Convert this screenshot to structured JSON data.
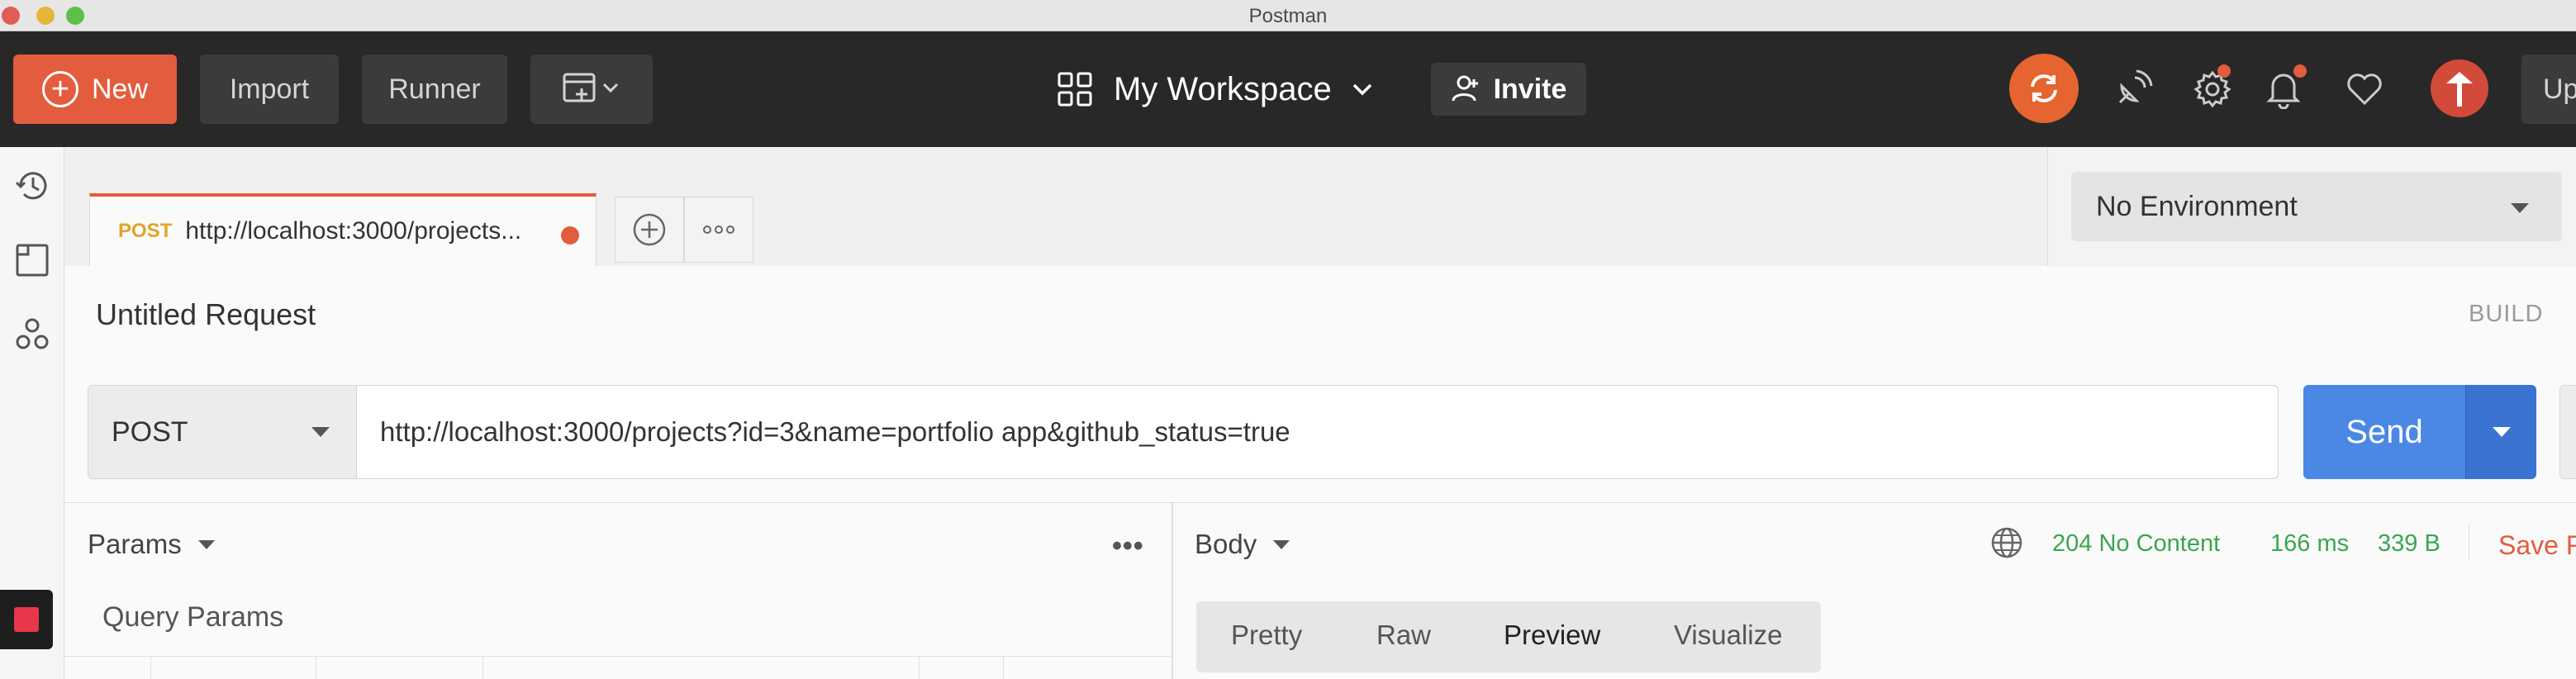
{
  "window": {
    "title": "Postman"
  },
  "header": {
    "new_label": "New",
    "import_label": "Import",
    "runner_label": "Runner",
    "workspace_label": "My Workspace",
    "invite_label": "Invite",
    "upgrade_label": "Up"
  },
  "tabs": [
    {
      "method": "POST",
      "title": "http://localhost:3000/projects...",
      "unsaved": true
    }
  ],
  "environment": {
    "selected": "No Environment"
  },
  "request": {
    "name": "Untitled Request",
    "build_label": "BUILD",
    "method": "POST",
    "url": "http://localhost:3000/projects?id=3&name=portfolio app&github_status=true",
    "send_label": "Send"
  },
  "params": {
    "section_label": "Params",
    "query_params_label": "Query Params"
  },
  "response": {
    "section_label": "Body",
    "status": "204 No Content",
    "time": "166 ms",
    "size": "339 B",
    "save_label": "Save R",
    "view_tabs": [
      "Pretty",
      "Raw",
      "Preview",
      "Visualize"
    ],
    "active_view": "Preview"
  },
  "colors": {
    "accent": "#e35c3d",
    "send": "#4b88e6",
    "success": "#3aa650",
    "header_bg": "#282828"
  }
}
